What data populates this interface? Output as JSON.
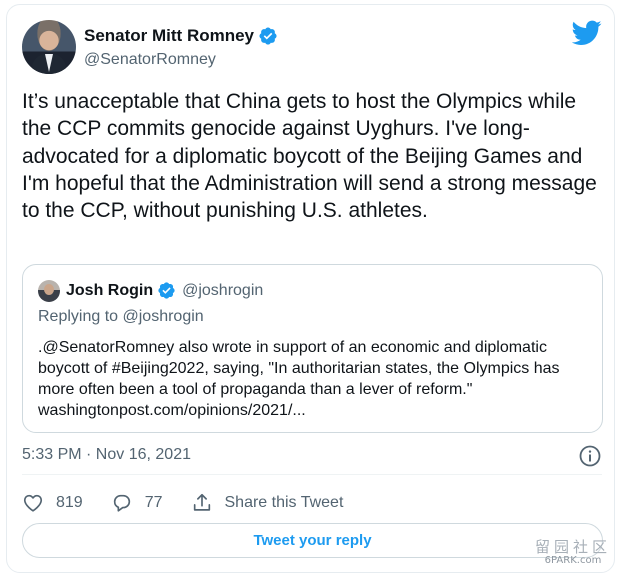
{
  "author": {
    "display_name": "Senator Mitt Romney",
    "handle": "@SenatorRomney"
  },
  "tweet_text": "It’s unacceptable that China gets to host the Olympics while the CCP commits genocide against Uyghurs. I've long-advocated for a diplomatic boycott of the Beijing Games and I'm hopeful that the Administration will send a strong message to the CCP, without punishing U.S. athletes.",
  "quote": {
    "display_name": "Josh Rogin",
    "handle": "@joshrogin",
    "replying_prefix": "Replying to",
    "replying_to": "@joshrogin",
    "text": ".@SenatorRomney also wrote in support of an economic and diplomatic boycott of #Beijing2022, saying, \"In authoritarian states, the Olympics has more often been a tool of propaganda than a lever of reform.\" washingtonpost.com/opinions/2021/..."
  },
  "timestamp": "5:33 PM · Nov 16, 2021",
  "actions": {
    "like_count": "819",
    "reply_count": "77",
    "share_label": "Share this Tweet"
  },
  "reply_button_label": "Tweet your reply",
  "watermark": {
    "chinese": "留园社区",
    "url": "6PARK.com"
  },
  "colors": {
    "accent": "#1d9bf0",
    "text_primary": "#0f1419",
    "text_secondary": "#536471",
    "border": "#cfd9de"
  },
  "icons": [
    "verified-badge-icon",
    "twitter-bird-icon",
    "info-icon",
    "heart-icon",
    "reply-bubble-icon",
    "share-icon"
  ]
}
